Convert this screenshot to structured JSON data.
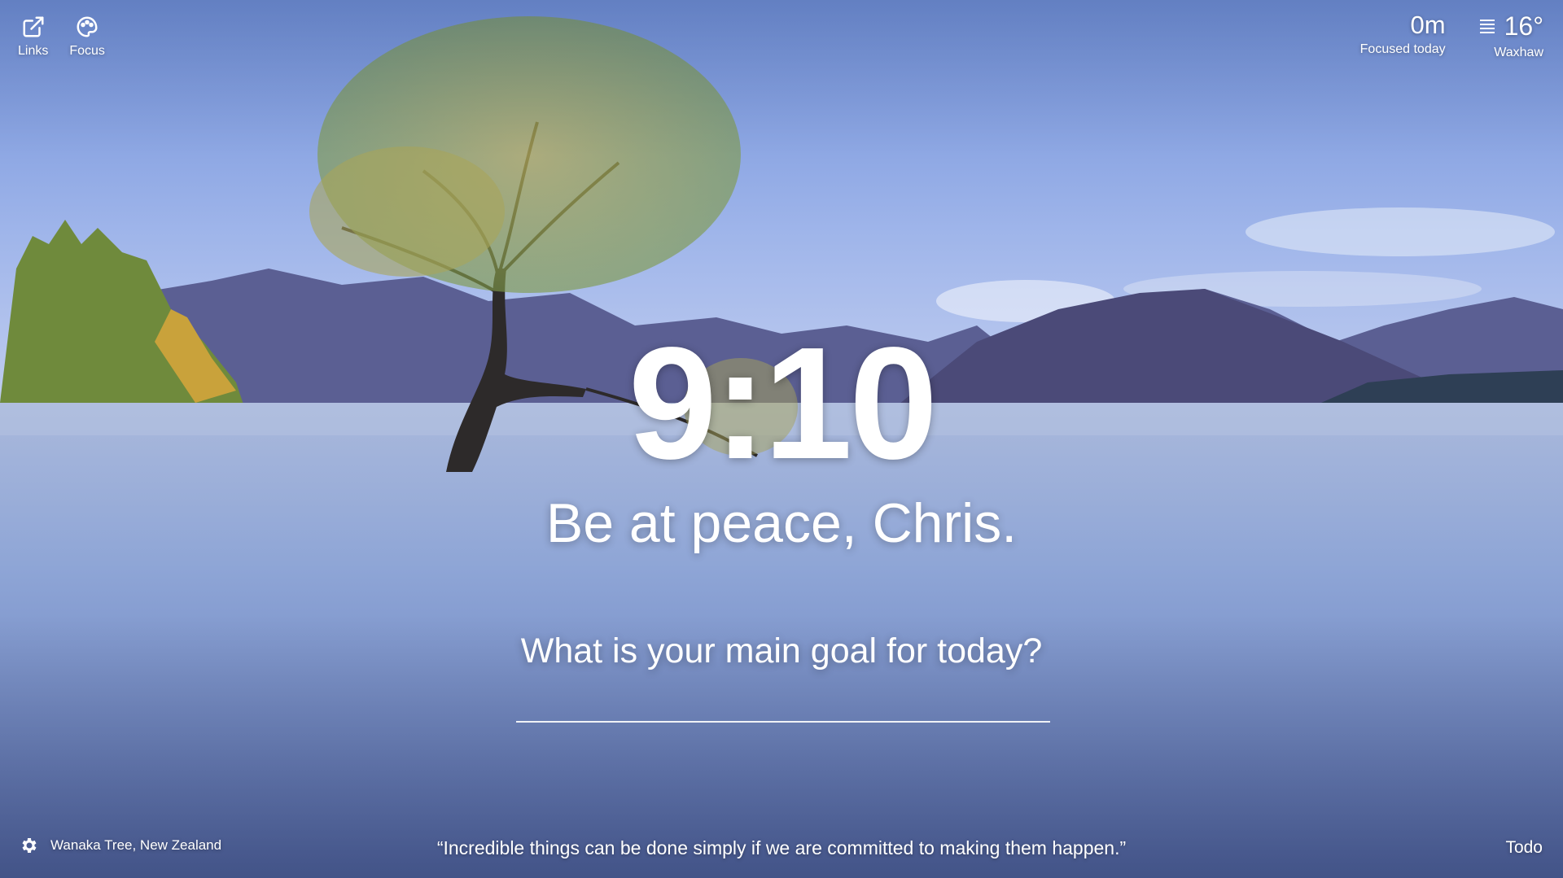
{
  "topbar": {
    "links": {
      "label": "Links",
      "icon": "external-link-icon"
    },
    "focus": {
      "label": "Focus",
      "icon": "palette-icon"
    }
  },
  "focus_stat": {
    "value": "0m",
    "label": "Focused today"
  },
  "weather": {
    "icon": "fog-icon",
    "temperature": "16°",
    "location": "Waxhaw"
  },
  "clock": {
    "time": "9:10"
  },
  "greeting": "Be at peace, Chris.",
  "main_goal": {
    "question": "What is your main goal for today?",
    "value": ""
  },
  "footer": {
    "settings_icon": "gear-icon",
    "photo_location": "Wanaka Tree, New Zealand",
    "quote": "“Incredible things can be done simply if we are committed to making them happen.”",
    "todo_label": "Todo"
  },
  "colors": {
    "sky_top": "#6f8fd6",
    "sky_horizon": "#b7c7ee",
    "lake": "#7f9ad0",
    "text": "#ffffff"
  }
}
